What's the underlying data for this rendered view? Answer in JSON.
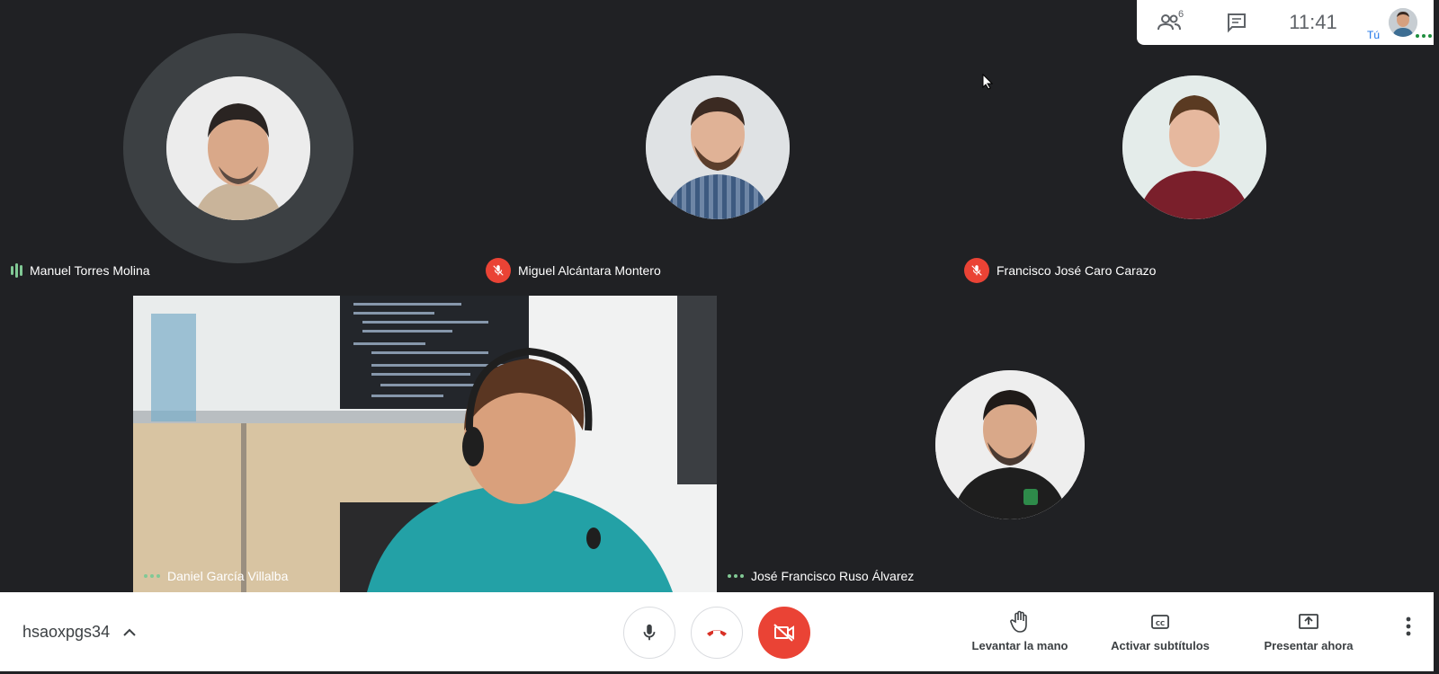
{
  "participants": [
    {
      "name": "Manuel Torres Molina",
      "state": "speaking"
    },
    {
      "name": "Miguel Alcántara Montero",
      "state": "muted"
    },
    {
      "name": "Francisco José Caro Carazo",
      "state": "muted"
    },
    {
      "name": "Daniel García Villalba",
      "state": "video"
    },
    {
      "name": "José Francisco Ruso Álvarez",
      "state": "idle"
    }
  ],
  "topbar": {
    "participant_count": "6",
    "time": "11:41",
    "self_label": "Tú"
  },
  "bottombar": {
    "meeting_code": "hsaoxpgs34",
    "raise_hand": "Levantar la mano",
    "captions": "Activar subtítulos",
    "present": "Presentar ahora"
  },
  "colors": {
    "background": "#202124",
    "muted_red": "#ea4335",
    "speaking_green": "#81c995",
    "dots_blue": "#8ab4f8"
  }
}
